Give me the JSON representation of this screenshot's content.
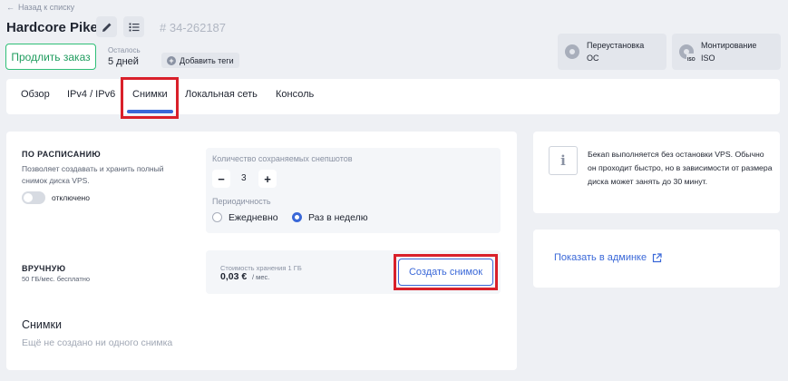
{
  "header": {
    "back_label": "Назад к списку",
    "server_name": "Hardcore Pike",
    "server_id": "# 34-262187"
  },
  "actions": {
    "extend_label": "Продлить заказ",
    "remain_label": "Осталось",
    "remain_value": "5 дней",
    "add_tags_label": "Добавить теги",
    "reinstall_line1": "Переустановка",
    "reinstall_line2": "ОС",
    "mount_line1": "Монтирование",
    "mount_line2": "ISO"
  },
  "tabs": [
    {
      "label": "Обзор"
    },
    {
      "label": "IPv4 / IPv6"
    },
    {
      "label": "Снимки"
    },
    {
      "label": "Локальная сеть"
    },
    {
      "label": "Консоль"
    }
  ],
  "schedule": {
    "title": "ПО РАСПИСАНИЮ",
    "description": "Позволяет создавать и хранить полный снимок диска VPS.",
    "toggle_label": "отключено",
    "count_label": "Количество сохраняемых снепшотов",
    "count_value": "3",
    "period_label": "Периодичность",
    "option_daily": "Ежедневно",
    "option_weekly": "Раз в неделю",
    "selected": "weekly"
  },
  "manual": {
    "title": "ВРУЧНУЮ",
    "subtitle": "50 ГБ/мес. бесплатно",
    "cost_label": "Стоимость хранения 1 ГБ",
    "cost_value": "0,03 €",
    "cost_unit": "/ мес.",
    "create_label": "Создать снимок"
  },
  "snapshots": {
    "title": "Снимки",
    "empty_text": "Ещё не создано ни одного снимка"
  },
  "info": {
    "text": "Бекап выполняется без остановки VPS. Обычно он проходит быстро, но в зависимости от размера диска может занять до 30 минут."
  },
  "admin": {
    "link_label": "Показать в админке"
  },
  "colors": {
    "accent": "#3a68d8",
    "success": "#2fbf77",
    "highlight": "#d9202a"
  }
}
